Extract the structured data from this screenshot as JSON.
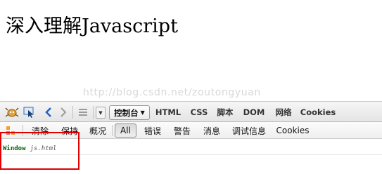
{
  "page": {
    "heading": "深入理解Javascript",
    "watermark": "http://blog.csdn.net/zoutongyuan"
  },
  "toolbar": {
    "console_tab": "控制台",
    "tabs": [
      "HTML",
      "CSS",
      "脚本",
      "DOM",
      "网络",
      "Cookies"
    ]
  },
  "subtoolbar": {
    "actions": [
      "清除",
      "保持",
      "概况"
    ],
    "filters": [
      "All",
      "错误",
      "警告",
      "消息",
      "调试信息",
      "Cookies"
    ]
  },
  "console": {
    "entries": [
      {
        "object": "Window",
        "source": "js.html"
      }
    ]
  },
  "colors": {
    "highlight": "#e00000",
    "log_object": "#006400",
    "nav_blue": "#1a5fc8"
  }
}
